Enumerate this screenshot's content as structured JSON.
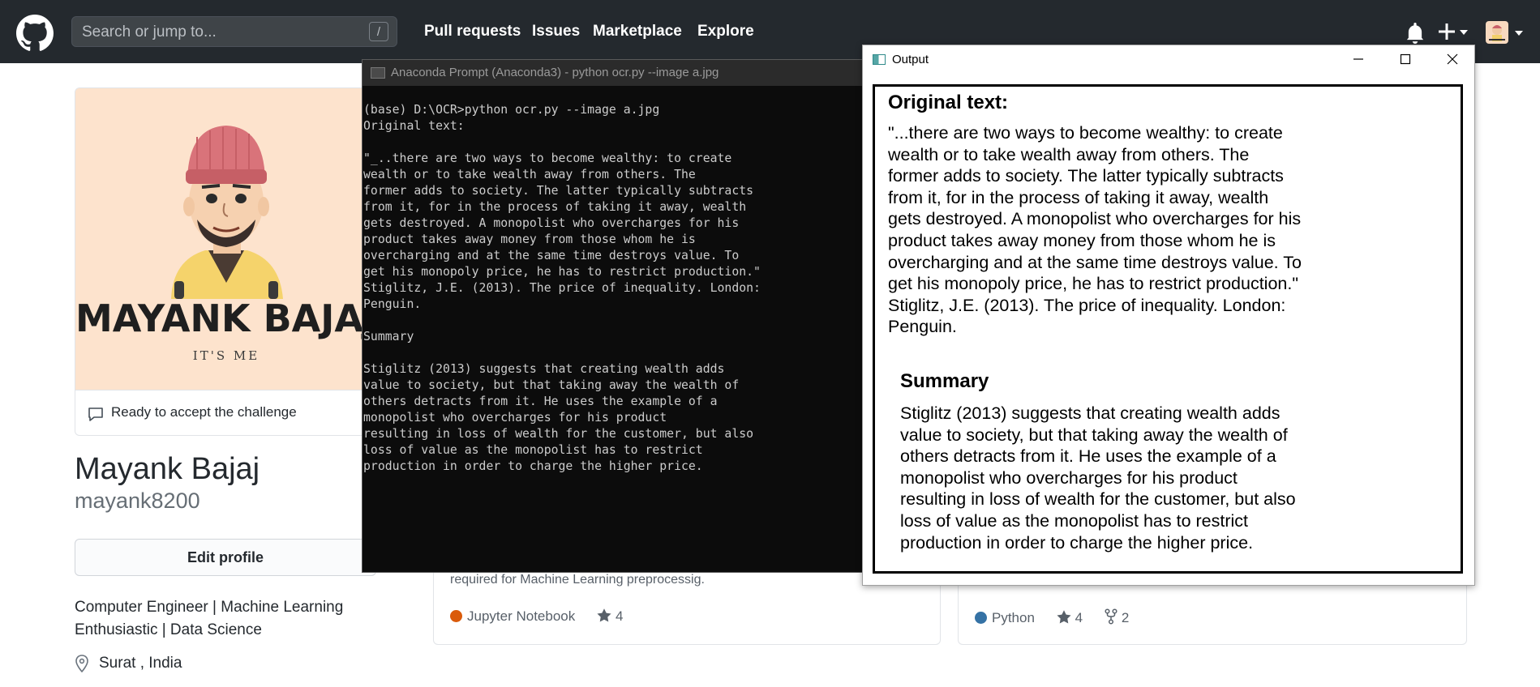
{
  "header": {
    "search_placeholder": "Search or jump to...",
    "search_shortcut": "/",
    "nav": [
      "Pull requests",
      "Issues",
      "Marketplace",
      "Explore"
    ],
    "logo_icon": "github-mark-icon",
    "bell_icon": "bell-icon",
    "plus_icon": "plus-icon"
  },
  "profile": {
    "image_text": {
      "name": "MAYANK BAJAJ",
      "tagline": "IT'S ME"
    },
    "status": "Ready to accept the challenge",
    "name": "Mayank Bajaj",
    "login": "mayank8200",
    "edit_label": "Edit profile",
    "bio": "Computer Engineer | Machine Learning Enthusiastic | Data Science",
    "location": "Surat , India"
  },
  "repos": [
    {
      "description": "required for Machine Learning preprocessig.",
      "language": "Jupyter Notebook",
      "language_color": "#DA5B0B",
      "stars": "4"
    },
    {
      "language": "Python",
      "language_color": "#3572A5",
      "stars": "4",
      "forks": "2"
    }
  ],
  "terminal": {
    "title": "Anaconda Prompt (Anaconda3) - python  ocr.py --image a.jpg",
    "output": "(base) D:\\OCR>python ocr.py --image a.jpg\nOriginal text:\n\n\"_..there are two ways to become wealthy: to create\nwealth or to take wealth away from others. The\nformer adds to society. The latter typically subtracts\nfrom it, for in the process of taking it away, wealth\ngets destroyed. A monopolist who overcharges for his\nproduct takes away money from those whom he is\novercharging and at the same time destroys value. To\nget his monopoly price, he has to restrict production.\"\nStiglitz, J.E. (2013). The price of inequality. London:\nPenguin.\n\nSummary\n\nStiglitz (2013) suggests that creating wealth adds\nvalue to society, but that taking away the wealth of\nothers detracts from it. He uses the example of a\nmonopolist who overcharges for his product\nresulting in loss of wealth for the customer, but also\nloss of value as the monopolist has to restrict\nproduction in order to charge the higher price."
  },
  "output_window": {
    "title": "Output",
    "heading": "Original text:",
    "original": "\"...there are two ways to become wealthy: to create\nwealth or to take wealth away from others. The\nformer adds to society. The latter typically subtracts\nfrom it, for in the process of taking it away, wealth\ngets destroyed. A monopolist who overcharges for his\nproduct takes away money from those whom he is\novercharging and at the same time destroys value. To\nget his monopoly price, he has to restrict production.\"\nStiglitz, J.E. (2013). The price of inequality. London:\nPenguin.",
    "summary_heading": "Summary",
    "summary": "Stiglitz (2013) suggests that creating wealth adds\nvalue to society, but that taking away the wealth of\nothers detracts from it. He uses the example of a\nmonopolist who overcharges for his product\nresulting in loss of wealth for the customer, but also\nloss of value as the monopolist has to restrict\nproduction in order to charge the higher price."
  }
}
